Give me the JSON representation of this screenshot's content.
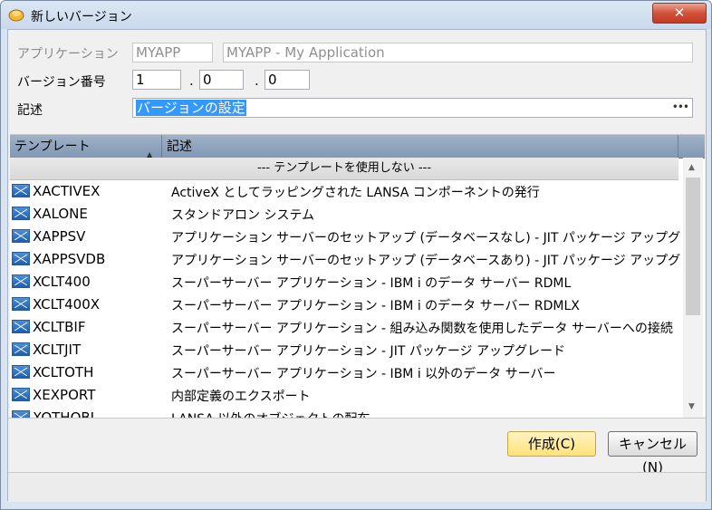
{
  "window": {
    "title": "新しいバージョン",
    "close_label": "✕"
  },
  "form": {
    "app_label": "アプリケーション",
    "app_code": "MYAPP",
    "app_name": "MYAPP - My Application",
    "version_label": "バージョン番号",
    "version": [
      "1",
      "0",
      "0"
    ],
    "version_sep": ".",
    "desc_label": "記述",
    "desc_value": "バージョンの設定",
    "desc_button": "•••"
  },
  "grid": {
    "col_template": "テンプレート",
    "col_desc": "記述",
    "sort_indicator": "▲",
    "no_template": "--- テンプレートを使用しない ---",
    "rows": [
      {
        "name": "XACTIVEX",
        "desc": "ActiveX としてラッピングされた LANSA コンポーネントの発行"
      },
      {
        "name": "XALONE",
        "desc": "スタンドアロン システム"
      },
      {
        "name": "XAPPSV",
        "desc": "アプリケーション サーバーのセットアップ (データベースなし) - JIT パッケージ アップグレード"
      },
      {
        "name": "XAPPSVDB",
        "desc": "アプリケーション サーバーのセットアップ (データベースあり) - JIT パッケージ アップグレード"
      },
      {
        "name": "XCLT400",
        "desc": "スーパーサーバー アプリケーション - IBM i のデータ サーバー RDML"
      },
      {
        "name": "XCLT400X",
        "desc": "スーパーサーバー アプリケーション - IBM i のデータ サーバー RDMLX"
      },
      {
        "name": "XCLTBIF",
        "desc": "スーパーサーバー アプリケーション - 組み込み関数を使用したデータ サーバーへの接続"
      },
      {
        "name": "XCLTJIT",
        "desc": "スーパーサーバー アプリケーション - JIT パッケージ アップグレード"
      },
      {
        "name": "XCLTOTH",
        "desc": "スーパーサーバー アプリケーション - IBM i 以外のデータ サーバー"
      },
      {
        "name": "XEXPORT",
        "desc": "内部定義のエクスポート"
      },
      {
        "name": "XOTHOBJ",
        "desc": "LANSA 以外のオブジェクトの配布"
      }
    ]
  },
  "buttons": {
    "create": "作成(C)",
    "cancel": "キャンセル(N)"
  },
  "icons": {
    "app": "app-icon",
    "row": "template-icon",
    "close": "close-icon"
  },
  "colors": {
    "selection": "#3399ff",
    "header": "#8fa4bf",
    "create_button": "#ffe27a"
  }
}
